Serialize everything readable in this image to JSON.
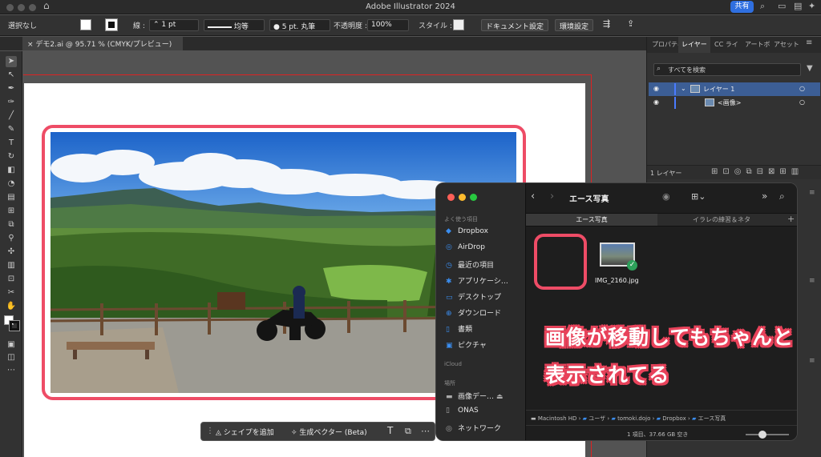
{
  "app": {
    "title": "Adobe Illustrator 2024",
    "share_label": "共有"
  },
  "control_bar": {
    "selection": "選択なし",
    "stroke_label": "線 :",
    "stroke_weight": "1 pt",
    "stroke_profile": "均等",
    "brush": "5 pt. 丸筆",
    "opacity_label": "不透明度 :",
    "opacity_value": "100%",
    "style_label": "スタイル :",
    "doc_setup": "ドキュメント設定",
    "preferences": "環境設定"
  },
  "document_tab": {
    "label": "デモ2.ai @ 95.71 % (CMYK/プレビュー)"
  },
  "context_bar": {
    "add_shape": "シェイプを追加",
    "generative_vector": "生成ベクター (Beta)"
  },
  "panels": {
    "tabs": [
      "プロパティ",
      "レイヤー",
      "CC ライ",
      "アートボ",
      "アセット"
    ],
    "search_placeholder": "すべてを検索",
    "layers": [
      {
        "name": "レイヤー 1"
      },
      {
        "name": "<画像>"
      }
    ],
    "layer_count": "1 レイヤー"
  },
  "finder": {
    "title": "エース写真",
    "sidebar": {
      "favorites_header": "よく使う項目",
      "favorites": [
        {
          "label": "Dropbox",
          "icon": "dropbox-icon"
        },
        {
          "label": "AirDrop",
          "icon": "airdrop-icon"
        },
        {
          "label": "最近の項目",
          "icon": "clock-icon"
        },
        {
          "label": "アプリケーシ…",
          "icon": "apps-icon"
        },
        {
          "label": "デスクトップ",
          "icon": "desktop-icon"
        },
        {
          "label": "ダウンロード",
          "icon": "download-icon"
        },
        {
          "label": "書類",
          "icon": "document-icon"
        },
        {
          "label": "ピクチャ",
          "icon": "picture-icon"
        }
      ],
      "icloud_header": "iCloud",
      "locations_header": "場所",
      "locations": [
        {
          "label": "画像デー…",
          "icon": "disk-icon"
        },
        {
          "label": "ONAS",
          "icon": "server-icon"
        },
        {
          "label": "ネットワーク",
          "icon": "network-icon"
        }
      ]
    },
    "tabs": [
      "エース写真",
      "イラレの練習＆ネタ"
    ],
    "file": {
      "name": "IMG_2160.jpg"
    },
    "path": [
      "Macintosh HD",
      "ユーザ",
      "tomoki.dojo",
      "Dropbox",
      "エース写真"
    ],
    "status": "1 項目、37.66 GB 空き"
  },
  "annotation": {
    "line1": "画像が移動してもちゃんと",
    "line2": "表示されてる"
  },
  "colors": {
    "accent": "#2f6fe0",
    "highlight": "#ee4c66"
  }
}
